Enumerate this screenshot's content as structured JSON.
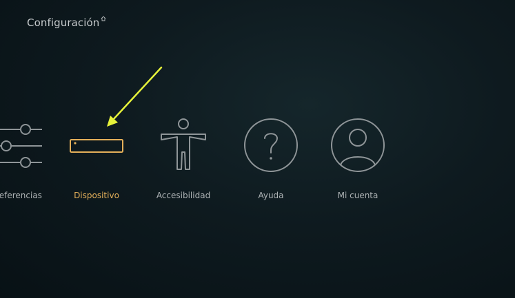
{
  "header": {
    "title": "Configuración",
    "home_icon": "home-icon"
  },
  "categories": [
    {
      "label": "Preferencias",
      "icon": "sliders-icon",
      "selected": false
    },
    {
      "label": "Dispositivo",
      "icon": "device-box-icon",
      "selected": true
    },
    {
      "label": "Accesibilidad",
      "icon": "accessibility-person-icon",
      "selected": false
    },
    {
      "label": "Ayuda",
      "icon": "help-question-icon",
      "selected": false
    },
    {
      "label": "Mi cuenta",
      "icon": "user-account-icon",
      "selected": false
    }
  ],
  "colors": {
    "background": "#0e1a1f",
    "icon_stroke": "#8f9598",
    "selected_accent": "#e5b05a",
    "label_default": "#aeb3b5",
    "annotation_arrow": "#e6f23a"
  }
}
